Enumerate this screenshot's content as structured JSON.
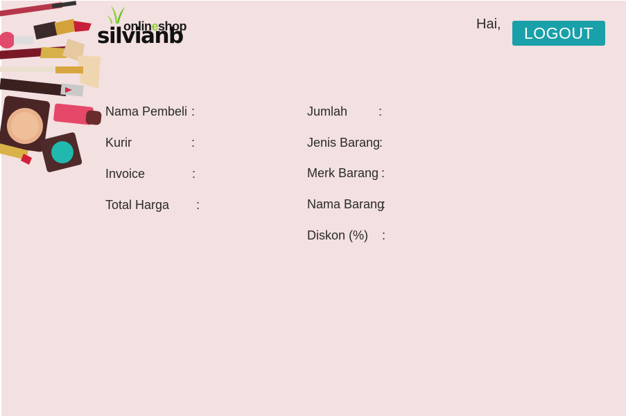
{
  "header": {
    "logo_online": "onlin",
    "logo_online_e": "e",
    "logo_shop": "shop",
    "logo_brand": "silvianb",
    "greeting": "Hai,",
    "logout_label": "LOGOUT"
  },
  "details_left": [
    {
      "label": "Nama Pembeli",
      "colon": ":"
    },
    {
      "label": "Kurir",
      "colon": ":"
    },
    {
      "label": "Invoice",
      "colon": ":"
    },
    {
      "label": "Total Harga",
      "colon": ":"
    }
  ],
  "details_right": [
    {
      "label": "Jumlah",
      "colon": ":"
    },
    {
      "label": "Jenis Barang",
      "colon": ":"
    },
    {
      "label": "Merk Barang",
      "colon": ":"
    },
    {
      "label": "Nama Barang",
      "colon": ":"
    },
    {
      "label": "Diskon (%)",
      "colon": ":"
    }
  ],
  "colors": {
    "background": "#f3e0e0",
    "accent": "#1aa0a8",
    "logo_green": "#8bd13a"
  }
}
